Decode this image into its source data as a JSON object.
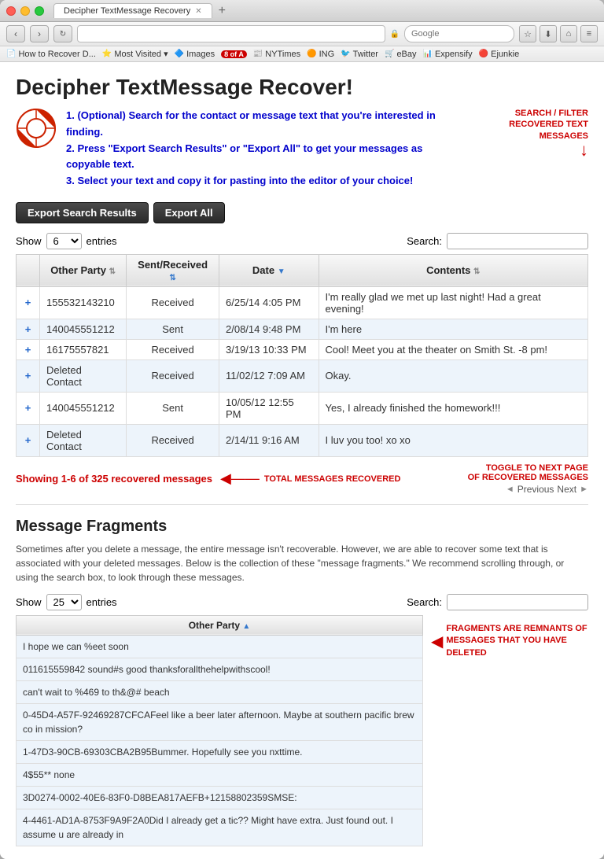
{
  "browser": {
    "tab_title": "Decipher TextMessage Recovery",
    "tab_plus": "+",
    "nav_back": "‹",
    "nav_forward": "›",
    "address": "",
    "search_placeholder": "Google",
    "bookmarks": [
      {
        "icon": "📄",
        "label": "How to Recover D..."
      },
      {
        "icon": "⭐",
        "label": "Most Visited ▾"
      },
      {
        "icon": "🔷",
        "label": "Images"
      },
      {
        "icon": "🔴",
        "badge": "8 of A",
        "label": "8 of A"
      },
      {
        "icon": "📰",
        "label": "NYTimes"
      },
      {
        "icon": "🟠",
        "label": "ING"
      },
      {
        "icon": "🐦",
        "label": "Twitter"
      },
      {
        "icon": "🛒",
        "label": "eBay"
      },
      {
        "icon": "📊",
        "label": "Expensify"
      },
      {
        "icon": "🔴",
        "label": "Ejunkie"
      }
    ]
  },
  "page": {
    "title": "Decipher TextMessage Recover!",
    "instructions": [
      "(Optional) Search for the contact or message text that you're interested in finding.",
      "Press \"Export Search Results\" or \"Export All\" to get your messages as copyable text.",
      "Select your text and copy it for pasting into the editor of your choice!"
    ],
    "annotation_search": "SEARCH / FILTER\nRECOVERED TEXT MESSAGES",
    "btn_export_search": "Export Search Results",
    "btn_export_all": "Export All",
    "show_label": "Show",
    "entries_label": "entries",
    "show_value": "6",
    "search_label": "Search:",
    "table": {
      "columns": [
        "Other Party",
        "Sent/Received",
        "Date",
        "Contents"
      ],
      "rows": [
        {
          "plus": "+",
          "party": "155532143210",
          "direction": "Received",
          "date": "6/25/14  4:05 PM",
          "contents": "I'm really glad we met up last night! Had a great evening!"
        },
        {
          "plus": "+",
          "party": "140045551212",
          "direction": "Sent",
          "date": "2/08/14  9:48 PM",
          "contents": "I'm here"
        },
        {
          "plus": "+",
          "party": "16175557821",
          "direction": "Received",
          "date": "3/19/13  10:33 PM",
          "contents": "Cool! Meet you at the theater on Smith St. -8 pm!"
        },
        {
          "plus": "+",
          "party": "Deleted Contact",
          "direction": "Received",
          "date": "11/02/12  7:09 AM",
          "contents": "Okay."
        },
        {
          "plus": "+",
          "party": "140045551212",
          "direction": "Sent",
          "date": "10/05/12  12:55 PM",
          "contents": "Yes, I already finished the homework!!!"
        },
        {
          "plus": "+",
          "party": "Deleted Contact",
          "direction": "Received",
          "date": "2/14/11  9:16 AM",
          "contents": "I luv you too! xo xo"
        }
      ]
    },
    "showing_text": "Showing 1-6 of ",
    "total_count": "325",
    "showing_suffix": " recovered messages",
    "annotation_total": "TOTAL MESSAGES RECOVERED",
    "annotation_toggle": "TOGGLE TO NEXT PAGE\nOF RECOVERED MESSAGES",
    "btn_previous": "Previous",
    "btn_next": "Next",
    "fragments_title": "Message Fragments",
    "fragments_desc": "Sometimes after you delete a message, the entire message isn't recoverable. However, we are able to recover some text that is associated with your deleted messages. Below is the collection of these \"message fragments.\" We recommend scrolling through, or using the search box, to look through these messages.",
    "fragments_show_value": "25",
    "fragments_search_label": "Search:",
    "fragments_column": "Other Party",
    "fragment_annotation": "FRAGMENTS ARE REMNANTS OF\nMESSAGES THAT YOU HAVE DELETED",
    "fragments": [
      "I hope we can %eet soon",
      "011615559842    sound#s good  thanksforallthehelpwithscool!",
      "can't wait to %469 to th&@# beach",
      "0-45D4-A57F-92469287CFCAFeel like a beer later afternoon. Maybe at southern pacific brew co in mission?",
      "1-47D3-90CB-69303CBA2B95Bummer. Hopefully see you nxttime.",
      "4$55** none",
      "3D0274-0002-40E6-83F0-D8BEA817AEFB+12158802359SMSE:",
      "4-4461-AD1A-8753F9A9F2A0Did I already get a tic?? Might have extra. Just found out. I assume u are already in"
    ]
  }
}
